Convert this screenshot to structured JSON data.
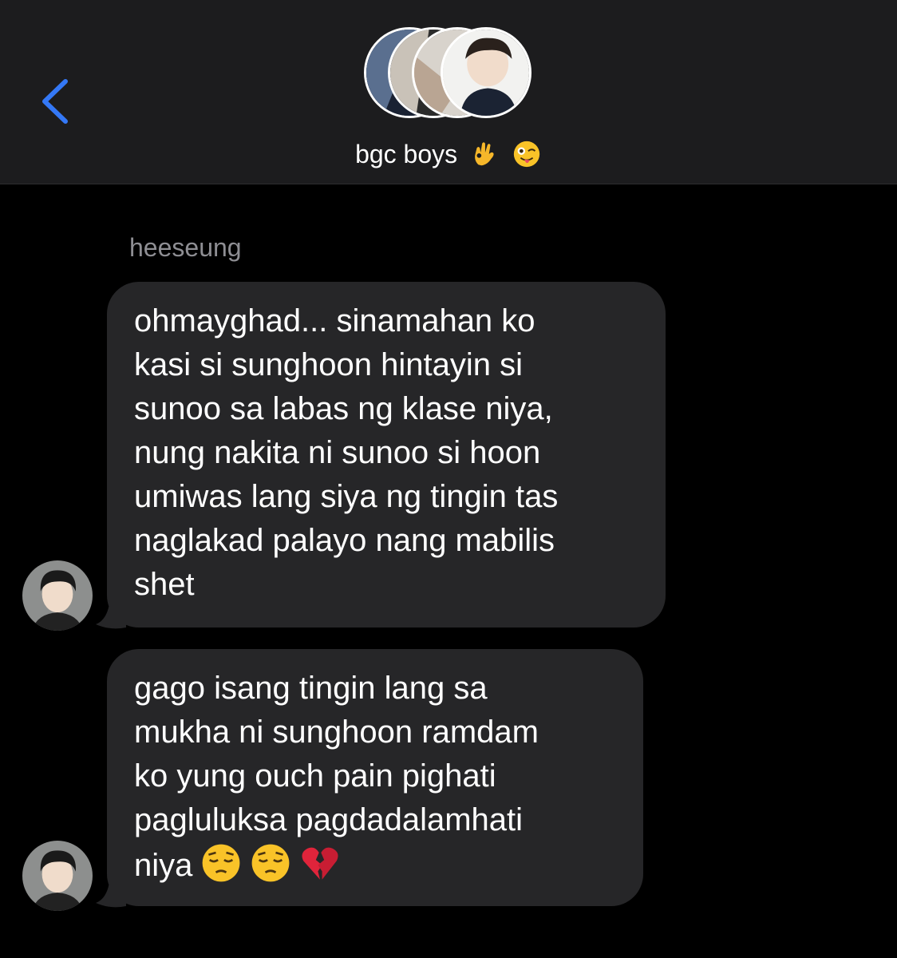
{
  "header": {
    "back_icon": "chevron-left-icon",
    "group_name": "bgc boys",
    "title_emojis": [
      "ok-hand-icon",
      "winking-face-tongue-icon"
    ],
    "accent_color": "#3478f6"
  },
  "conversation": {
    "sender_name": "heeseung",
    "messages": [
      {
        "text": "ohmayghad... sinamahan ko\nkasi si sunghoon hintayin si\nsunoo sa labas ng klase niya,\nnung nakita ni sunoo si hoon\numiwas lang siya ng tingin tas\nnaglakad palayo nang mabilis\nshet",
        "emojis": []
      },
      {
        "text": "gago isang tingin lang sa\nmukha ni sunghoon ramdam\nko yung ouch pain pighati\npagluluksa pagdadalamhati\nniya",
        "emojis": [
          "pensive-face-icon",
          "pensive-face-icon",
          "broken-heart-icon"
        ]
      }
    ]
  },
  "colors": {
    "background": "#000000",
    "header_bg": "#1c1c1e",
    "bubble_bg": "#262628",
    "sender_name": "#8e8e93"
  }
}
